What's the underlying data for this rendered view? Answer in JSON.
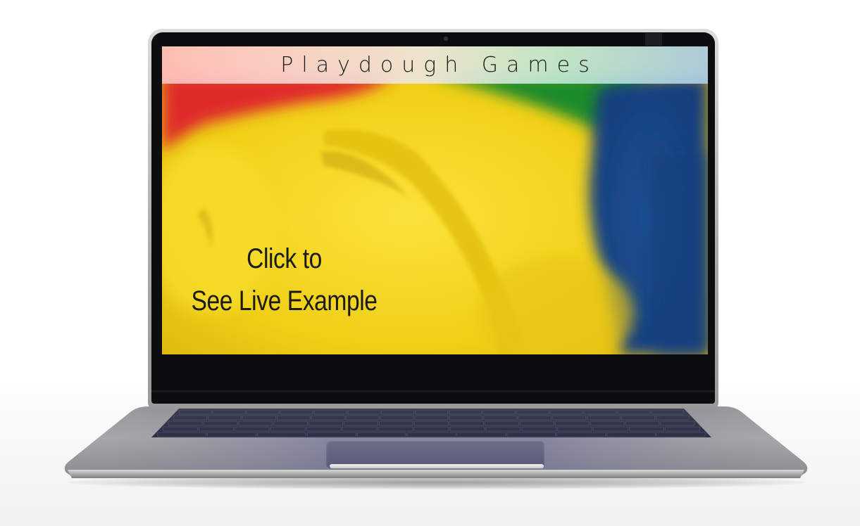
{
  "site": {
    "title": "Playdough Games"
  },
  "screen": {
    "cta_line_1": "Click to",
    "cta_line_2": "See Live Example"
  },
  "icons": {
    "camera": "webcam-dot"
  },
  "colors": {
    "playdough_yellow": "#f2d21a",
    "playdough_red": "#e2262c",
    "playdough_green": "#1a8a2a",
    "playdough_blue": "#1c5aa6",
    "header_left": "#ffbebe",
    "header_right": "#aacde8",
    "text": "#1a1a18"
  }
}
